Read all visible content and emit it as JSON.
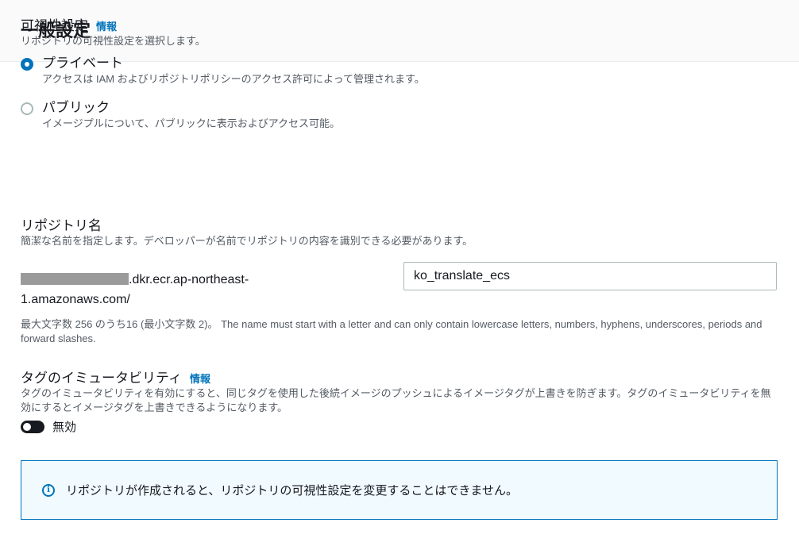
{
  "header": {
    "title": "一般設定"
  },
  "visibility": {
    "label": "可視性設定",
    "info": "情報",
    "description": "リポジトリの可視性設定を選択します。",
    "options": [
      {
        "title": "プライベート",
        "description": "アクセスは IAM およびリポジトリポリシーのアクセス許可によって管理されます。",
        "selected": true
      },
      {
        "title": "パブリック",
        "description": "イメージプルについて、パブリックに表示およびアクセス可能。",
        "selected": false
      }
    ]
  },
  "repo_name": {
    "label": "リポジトリ名",
    "description": "簡潔な名前を指定します。デベロッパーが名前でリポジトリの内容を識別できる必要があります。",
    "prefix_suffix": ".dkr.ecr.ap-northeast-1.amazonaws.com/",
    "value": "ko_translate_ecs",
    "constraint": "最大文字数 256 のうち16 (最小文字数 2)。 The name must start with a letter and can only contain lowercase letters, numbers, hyphens, underscores, periods and forward slashes."
  },
  "immutability": {
    "label": "タグのイミュータビリティ",
    "info": "情報",
    "description": "タグのイミュータビリティを有効にすると、同じタグを使用した後続イメージのプッシュによるイメージタグが上書きを防ぎます。タグのイミュータビリティを無効にするとイメージタグを上書きできるようになります。",
    "toggle_label": "無効",
    "enabled": false
  },
  "alert": {
    "icon": "info-icon",
    "text": "リポジトリが作成されると、リポジトリの可視性設定を変更することはできません。"
  },
  "colors": {
    "accent": "#0073bb",
    "alert_bg": "#f1faff"
  }
}
